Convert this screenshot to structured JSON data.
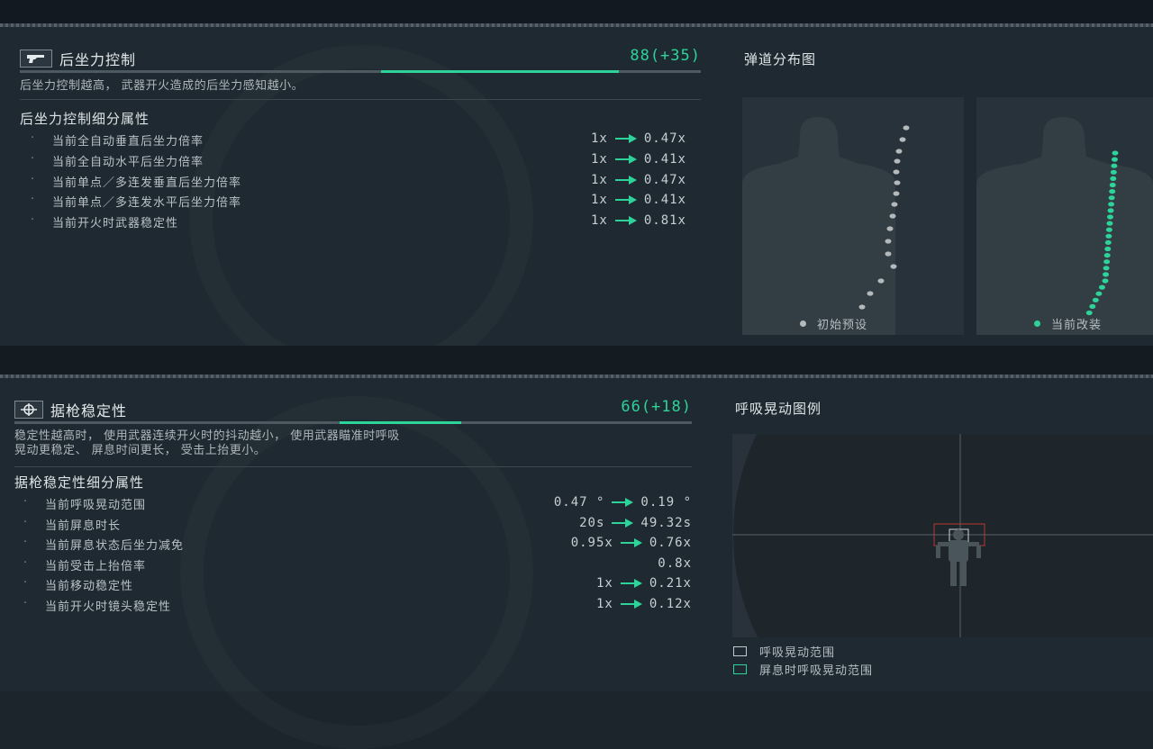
{
  "recoil": {
    "title": "后坐力控制",
    "score": "88(+35)",
    "base_fraction": 0.53,
    "bonus_fraction": 0.35,
    "description": "后坐力控制越高， 武器开火造成的后坐力感知越小。",
    "subtitle": "后坐力控制细分属性",
    "stats": [
      {
        "bullet": "·",
        "name": "当前全自动垂直后坐力倍率",
        "from": "1x",
        "to": "0.47x"
      },
      {
        "bullet": "·",
        "name": "当前全自动水平后坐力倍率",
        "from": "1x",
        "to": "0.41x"
      },
      {
        "bullet": "·",
        "name": "当前单点／多连发垂直后坐力倍率",
        "from": "1x",
        "to": "0.47x"
      },
      {
        "bullet": "·",
        "name": "当前单点／多连发水平后坐力倍率",
        "from": "1x",
        "to": "0.41x"
      },
      {
        "bullet": "·",
        "name": "当前开火时武器稳定性",
        "from": "1x",
        "to": "0.81x"
      }
    ]
  },
  "ballistics": {
    "title": "弹道分布图",
    "legend_initial": "初始预设",
    "legend_current": "当前改装",
    "initial_color": "#b4b9bc",
    "current_color": "#2ed39a"
  },
  "stability": {
    "title": "据枪稳定性",
    "score": "66(+18)",
    "base_fraction": 0.48,
    "bonus_fraction": 0.18,
    "description_line1": "稳定性越高时， 使用武器连续开火时的抖动越小， 使用武器瞄准时呼吸",
    "description_line2": "晃动更稳定、 屏息时间更长， 受击上抬更小。",
    "subtitle": "据枪稳定性细分属性",
    "stats": [
      {
        "bullet": "·",
        "name": "当前呼吸晃动范围",
        "from": "0.47 °",
        "to": "0.19 °"
      },
      {
        "bullet": "·",
        "name": "当前屏息时长",
        "from": "20s",
        "to": "49.32s"
      },
      {
        "bullet": "·",
        "name": "当前屏息状态后坐力减免",
        "from": "0.95x",
        "to": "0.76x"
      },
      {
        "bullet": "·",
        "name": "当前受击上抬倍率",
        "from": "",
        "to": "0.8x"
      },
      {
        "bullet": "·",
        "name": "当前移动稳定性",
        "from": "1x",
        "to": "0.21x"
      },
      {
        "bullet": "·",
        "name": "当前开火时镜头稳定性",
        "from": "1x",
        "to": "0.12x"
      }
    ]
  },
  "breath_sway": {
    "title": "呼吸晃动图例",
    "legend_1": "呼吸晃动范围",
    "legend_2": "屏息时呼吸晃动范围"
  }
}
